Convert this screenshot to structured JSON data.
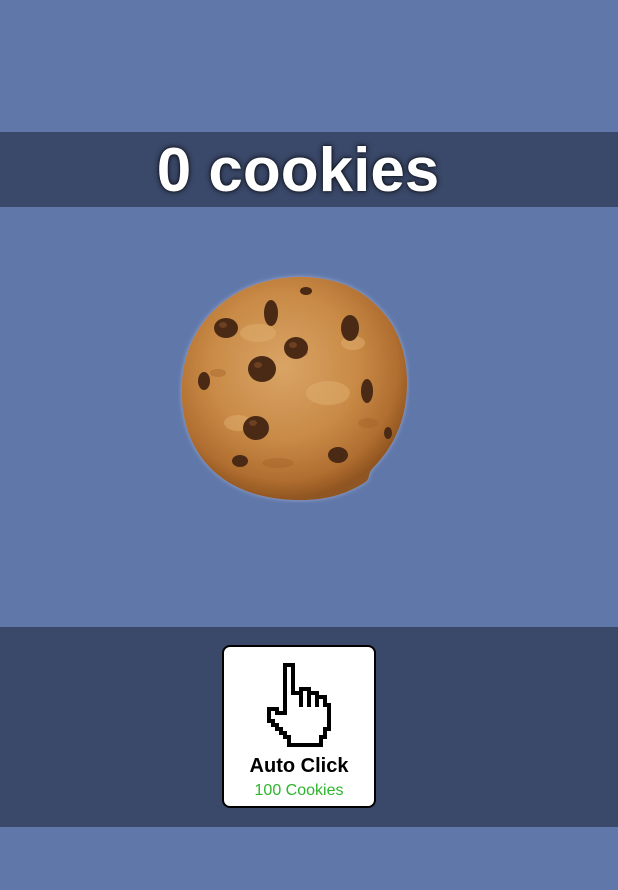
{
  "counter": {
    "text": "0 cookies"
  },
  "cookie": {
    "icon": "chocolate-chip-cookie-icon"
  },
  "shop": {
    "items": [
      {
        "name": "Auto Click",
        "cost": "100 Cookies",
        "icon": "pointing-hand-cursor-icon"
      }
    ]
  },
  "colors": {
    "background": "#6077aa",
    "bar": "#3a4869",
    "cost_text": "#2db52d",
    "counter_text": "#ffffff"
  }
}
